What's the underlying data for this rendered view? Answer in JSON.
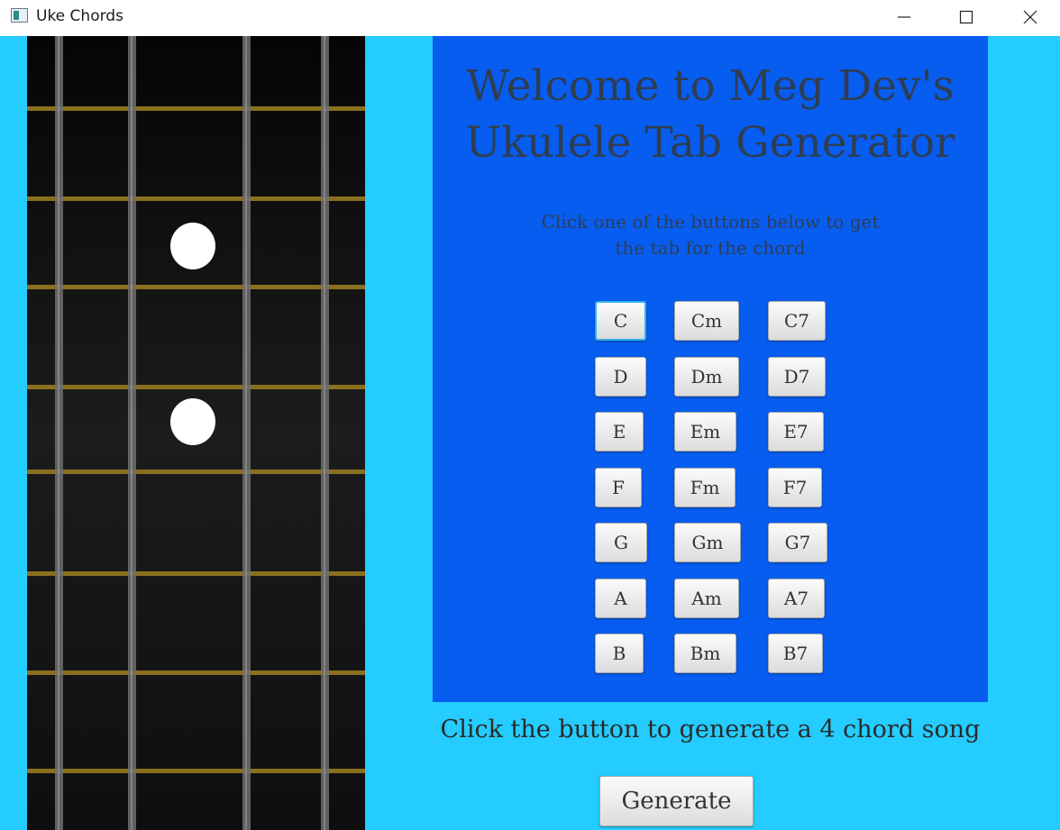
{
  "window": {
    "title": "Uke Chords",
    "controls": [
      "minimize-icon",
      "maximize-icon",
      "close-icon"
    ]
  },
  "fretboard": {
    "finger_positions": [
      {
        "string": 2,
        "fret": 3
      },
      {
        "string": 2,
        "fret": 5
      }
    ],
    "colors": {
      "wood": "#151515",
      "fret": "#8a6f1f",
      "dot": "#ffffff"
    }
  },
  "panel": {
    "heading": [
      "Welcome to Meg Dev's",
      "Ukulele Tab Generator"
    ],
    "subtitle": [
      "Click one of the buttons below to get",
      "the tab for the chord"
    ],
    "chords": [
      [
        "C",
        "Cm",
        "C7"
      ],
      [
        "D",
        "Dm",
        "D7"
      ],
      [
        "E",
        "Em",
        "E7"
      ],
      [
        "F",
        "Fm",
        "F7"
      ],
      [
        "G",
        "Gm",
        "G7"
      ],
      [
        "A",
        "Am",
        "A7"
      ],
      [
        "B",
        "Bm",
        "B7"
      ]
    ],
    "focused_chord": "C",
    "background": "#075df0"
  },
  "generator": {
    "prompt": "Click the button to generate a 4 chord song",
    "button_label": "Generate"
  },
  "colors": {
    "page_background": "#24ccff",
    "text": "#2f3d52"
  }
}
